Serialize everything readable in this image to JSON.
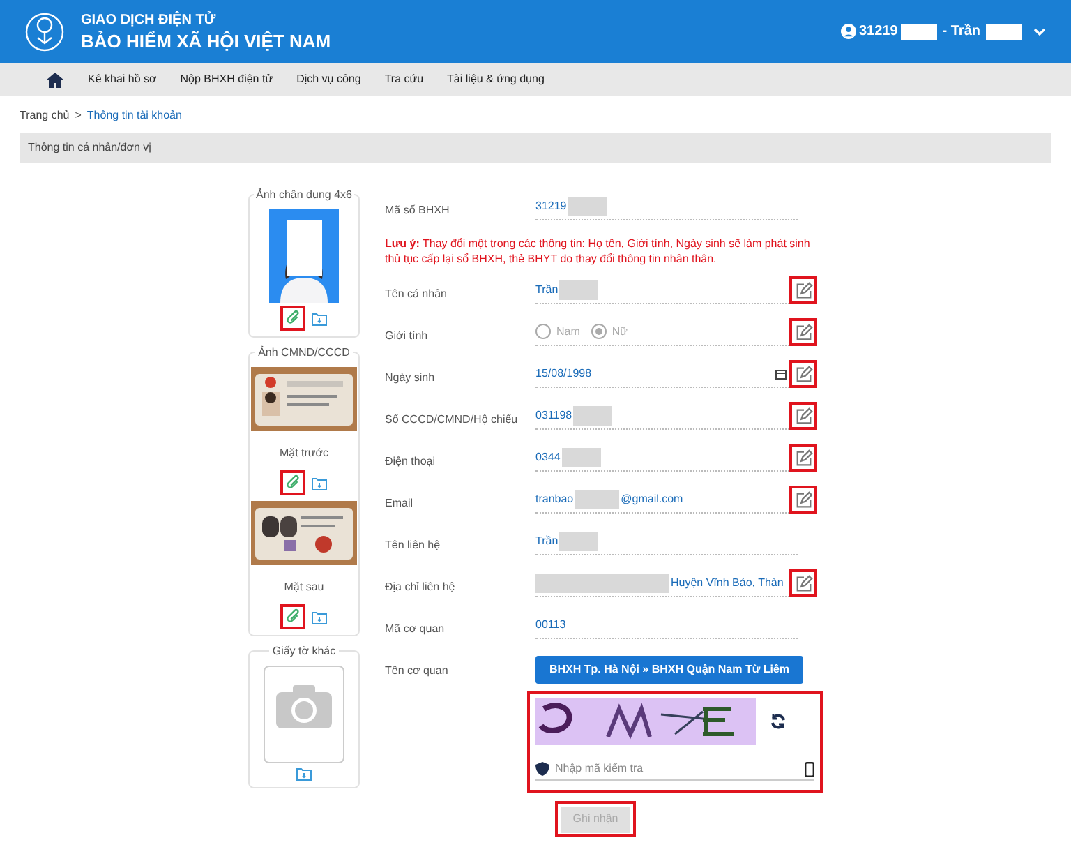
{
  "header": {
    "title_top": "GIAO DỊCH ĐIỆN TỬ",
    "title_main": "BẢO HIỂM XÃ HỘI VIỆT NAM",
    "user_id": "31219",
    "user_name": "- Trần"
  },
  "nav": {
    "items": [
      {
        "label": "Kê khai hồ sơ"
      },
      {
        "label": "Nộp BHXH điện tử"
      },
      {
        "label": "Dịch vụ công"
      },
      {
        "label": "Tra cứu"
      },
      {
        "label": "Tài liệu & ứng dụng"
      }
    ]
  },
  "breadcrumb": {
    "separator": ">",
    "items": [
      {
        "label": "Trang chủ",
        "selected": false
      },
      {
        "label": "Thông tin tài khoản",
        "selected": true
      }
    ]
  },
  "section_title": "Thông tin cá nhân/đơn vị",
  "documents": [
    {
      "title": "Ảnh chân dung 4x6",
      "sides": [
        {
          "kind": "portrait",
          "can_attach": true
        }
      ]
    },
    {
      "title": "Ảnh CMND/CCCD",
      "sides": [
        {
          "kind": "id_front",
          "caption": "Mặt trước",
          "can_attach": true
        },
        {
          "kind": "id_back",
          "caption": "Mặt sau",
          "can_attach": true
        }
      ]
    },
    {
      "title": "Giấy tờ khác",
      "sides": [
        {
          "kind": "empty",
          "can_attach": false
        }
      ]
    }
  ],
  "fields": [
    {
      "kind": "text",
      "label": "Mã số BHXH",
      "parts": [
        {
          "kind": "text",
          "text": "31219"
        },
        {
          "kind": "masked"
        }
      ],
      "editable": false
    },
    {
      "kind": "note",
      "text": "**Lưu ý:** Thay đổi một trong các thông tin: Họ tên, Giới tính, Ngày sinh sẽ làm phát sinh thủ tục cấp lại sổ BHXH, thẻ BHYT do thay đổi thông tin nhân thân."
    },
    {
      "kind": "text",
      "label": "Tên cá nhân",
      "parts": [
        {
          "kind": "text",
          "text": "Trần"
        },
        {
          "kind": "masked"
        }
      ],
      "editable": true
    },
    {
      "kind": "radio",
      "label": "Giới tính",
      "options": [
        {
          "label": "Nam",
          "selected": false
        },
        {
          "label": "Nữ",
          "selected": true
        }
      ],
      "editable": true
    },
    {
      "kind": "date",
      "label": "Ngày sinh",
      "value": "15/08/1998",
      "editable": true
    },
    {
      "kind": "text",
      "label": "Số CCCD/CMND/Hộ chiếu",
      "parts": [
        {
          "kind": "text",
          "text": "031198"
        },
        {
          "kind": "masked"
        }
      ],
      "editable": true
    },
    {
      "kind": "text",
      "label": "Điện thoại",
      "parts": [
        {
          "kind": "text",
          "text": "0344"
        },
        {
          "kind": "masked"
        }
      ],
      "editable": true
    },
    {
      "kind": "text",
      "label": "Email",
      "parts": [
        {
          "kind": "text",
          "text": "tranbao"
        },
        {
          "kind": "masked"
        },
        {
          "kind": "text",
          "text": "@gmail.com"
        }
      ],
      "editable": true
    },
    {
      "kind": "text",
      "label": "Tên liên hệ",
      "parts": [
        {
          "kind": "text",
          "text": "Trần"
        },
        {
          "kind": "masked"
        }
      ],
      "editable": false
    },
    {
      "kind": "text",
      "label": "Địa chỉ liên hệ",
      "parts": [
        {
          "kind": "masked_long"
        },
        {
          "kind": "text",
          "text": "Huyện Vĩnh Bảo, Thàn"
        }
      ],
      "editable": true
    },
    {
      "kind": "text",
      "label": "Mã cơ quan",
      "parts": [
        {
          "kind": "text",
          "text": "00113"
        }
      ],
      "editable": false
    },
    {
      "kind": "button",
      "label": "Tên cơ quan",
      "value": "BHXH Tp. Hà Nội » BHXH Quận Nam Từ Liêm"
    }
  ],
  "captcha": {
    "placeholder": "Nhập mã kiểm tra"
  },
  "submit": {
    "label": "Ghi nhận",
    "disabled": true
  }
}
